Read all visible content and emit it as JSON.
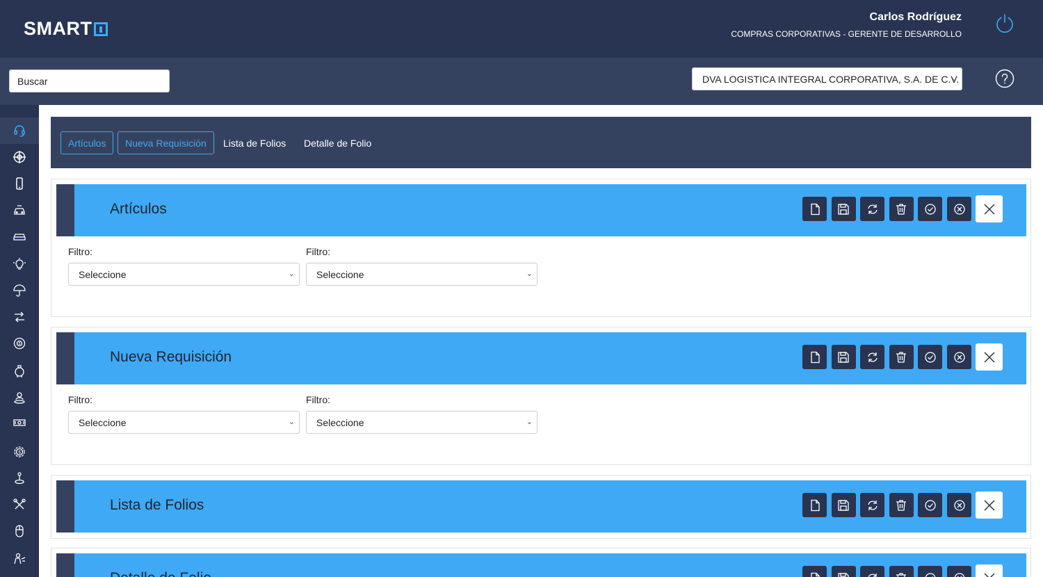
{
  "header": {
    "logo_text": "SMART",
    "user_name": "Carlos Rodríguez",
    "user_role": "COMPRAS CORPORATIVAS - GERENTE DE DESARROLLO",
    "power_icon": "power-icon"
  },
  "subbar": {
    "search_value": "Buscar",
    "company_selected": "DVA LOGISTICA INTEGRAL CORPORATIVA, S.A. DE C.V.",
    "help_icon": "help-icon"
  },
  "sidebar": {
    "items": [
      {
        "icon": "headset-icon"
      },
      {
        "icon": "crosshair-icon"
      },
      {
        "icon": "mobile-icon"
      },
      {
        "icon": "car-front-icon"
      },
      {
        "icon": "car-icon"
      },
      {
        "icon": "lightbulb-icon"
      },
      {
        "icon": "umbrella-icon"
      },
      {
        "icon": "transfer-icon"
      },
      {
        "icon": "globe-money-icon"
      },
      {
        "icon": "piggy-bank-icon"
      },
      {
        "icon": "person-location-icon"
      },
      {
        "icon": "cash-icon"
      },
      {
        "icon": "gear-dollar-icon"
      },
      {
        "icon": "joystick-icon"
      },
      {
        "icon": "tools-icon"
      },
      {
        "icon": "mouse-icon"
      },
      {
        "icon": "worker-icon"
      }
    ]
  },
  "tabs": [
    {
      "label": "Artículos"
    },
    {
      "label": "Nueva Requisición"
    },
    {
      "label": "Lista de Folios"
    },
    {
      "label": "Detalle de Folio"
    }
  ],
  "cards": [
    {
      "title": "Artículos",
      "filters": [
        {
          "label": "Filtro:",
          "value": "Seleccione"
        },
        {
          "label": "Filtro:",
          "value": "Seleccione"
        }
      ]
    },
    {
      "title": "Nueva Requisición",
      "filters": [
        {
          "label": "Filtro:",
          "value": "Seleccione"
        },
        {
          "label": "Filtro:",
          "value": "Seleccione"
        }
      ]
    },
    {
      "title": "Lista de Folios"
    },
    {
      "title": "Detalle de Folio"
    }
  ],
  "card_actions": [
    "new-file-icon",
    "save-icon",
    "refresh-icon",
    "trash-icon",
    "check-circle-icon",
    "cancel-circle-icon",
    "close-icon"
  ],
  "colors": {
    "header_bg": "#283451",
    "subbar_bg": "#35425f",
    "accent": "#3fa9f5"
  }
}
